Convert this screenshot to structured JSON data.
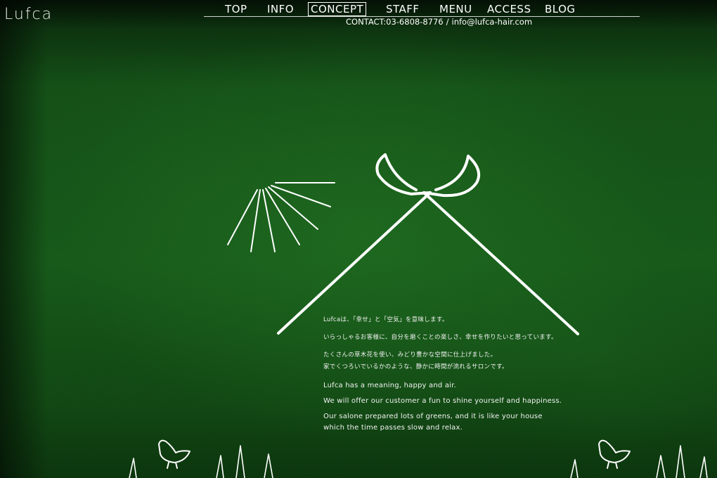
{
  "brand": {
    "logo": "Lufca"
  },
  "nav": {
    "items": [
      {
        "label": "TOP"
      },
      {
        "label": "INFO"
      },
      {
        "label": "CONCEPT",
        "active": true
      },
      {
        "label": "STAFF"
      },
      {
        "label": "MENU"
      },
      {
        "label": "ACCESS"
      },
      {
        "label": "BLOG"
      }
    ]
  },
  "contact": {
    "phone": "CONTACT:03-6808-8776",
    "separator": "/",
    "email": "info@lufca-hair.com"
  },
  "concept": {
    "jp_line1": "Lufcaは、「幸せ」と「空気」を意味します。",
    "jp_line2": "いらっしゃるお客様に、自分を磨くことの楽しさ、幸せを作りたいと思っています。",
    "jp_line3": "たくさんの草木花を使い、みどり豊かな空間に仕上げました。",
    "jp_line4": "家でくつろいでいるかのような、静かに時間が流れるサロンです。",
    "en_line1": "Lufca has a meaning, happy and air.",
    "en_line2": "We will offer our customer a fun to shine yourself and happiness.",
    "en_line3": "Our salone prepared lots of greens, and it is like your house",
    "en_line4": "which the time passes slow and relax."
  },
  "colors": {
    "background": "#1a5a1d",
    "text": "#ffffff"
  },
  "icons": [
    "scissors-mountain-icon",
    "sun-rays-icon",
    "bird-icon",
    "grass-icon"
  ]
}
